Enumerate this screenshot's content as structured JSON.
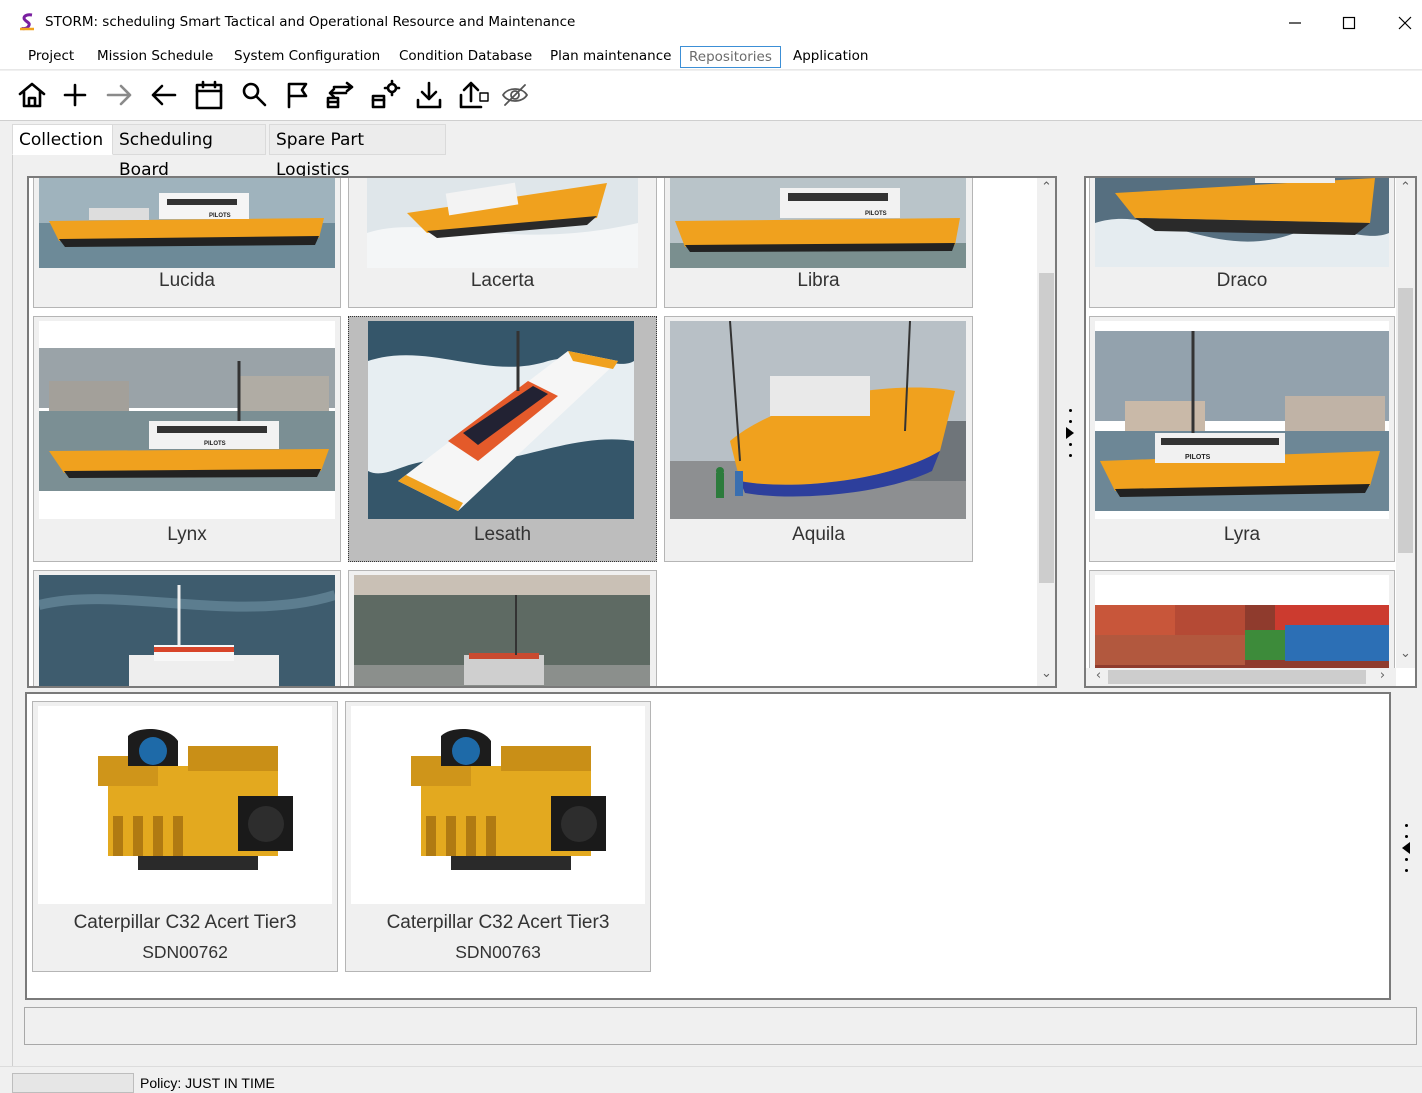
{
  "window": {
    "title": "STORM: scheduling Smart Tactical and Operational Resource and Maintenance"
  },
  "menu": [
    {
      "label": "Project"
    },
    {
      "label": "Mission Schedule"
    },
    {
      "label": "System Configuration"
    },
    {
      "label": "Condition Database"
    },
    {
      "label": "Plan maintenance"
    },
    {
      "label": "Repositories",
      "active": true
    },
    {
      "label": "Application"
    }
  ],
  "toolbar": [
    "home-icon",
    "add-icon",
    "forward-arrow-icon",
    "back-arrow-icon",
    "calendar-icon",
    "search-icon",
    "flag-icon",
    "swap-icon",
    "settings-swap-icon",
    "download-icon",
    "upload-icon",
    "eye-icon"
  ],
  "tabs": [
    {
      "label": "Collection",
      "active": true
    },
    {
      "label": "Scheduling Board"
    },
    {
      "label": "Spare Part Logistics"
    }
  ],
  "collection": {
    "vessels": [
      {
        "name": "Lucida"
      },
      {
        "name": "Lacerta"
      },
      {
        "name": "Libra"
      },
      {
        "name": "Lynx"
      },
      {
        "name": "Lesath",
        "selected": true
      },
      {
        "name": "Aquila"
      }
    ],
    "side_vessels": [
      {
        "name": "Draco"
      },
      {
        "name": "Lyra"
      }
    ],
    "components": [
      {
        "name": "Caterpillar C32 Acert Tier3",
        "serial": "SDN00762"
      },
      {
        "name": "Caterpillar C32 Acert Tier3",
        "serial": "SDN00763"
      }
    ]
  },
  "status": {
    "policy": "Policy: JUST IN TIME"
  },
  "colors": {
    "hull_orange": "#f0a11e",
    "hull_dark": "#2a2a2a",
    "engine_yellow": "#e3a91f",
    "selection_gray": "#bdbdbd",
    "menu_active_border": "#3c8fd6"
  }
}
